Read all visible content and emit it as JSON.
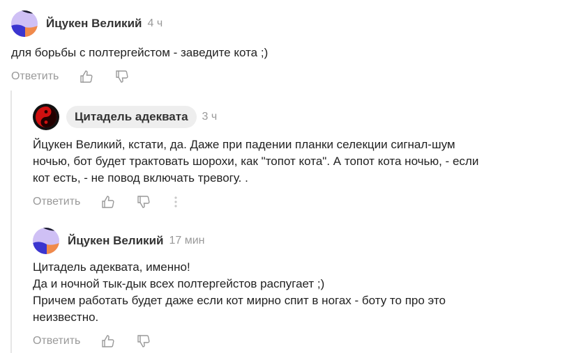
{
  "comments": [
    {
      "author": "Йцукен Великий",
      "time": "4 ч",
      "text": "для борьбы с полтергейстом - заведите кота ;)",
      "reply_label": "Ответить"
    },
    {
      "author": "Цитадель адеквата",
      "time": "3 ч",
      "text": "Йцукен Великий, кстати, да. Даже при падении планки селекции сигнал-шум\nночью, бот будет трактовать шорохи, как \"топот кота\". А топот кота ночью, - если\nкот есть, - не повод включать тревогу. .",
      "reply_label": "Ответить"
    },
    {
      "author": "Йцукен Великий",
      "time": "17 мин",
      "text": "Цитадель адеквата, именно!\nДа и ночной тык-дык всех полтергейстов распугает ;)\nПричем работать будет даже если кот мирно спит в ногах - боту то про это\nнеизвестно.",
      "reply_label": "Ответить"
    }
  ],
  "colors": {
    "avatar_lavender": "#cfc0f5",
    "avatar_blue": "#3b35cf",
    "avatar_orange": "#f08a4b",
    "avatar_red": "#d01010",
    "muted": "#999999"
  }
}
